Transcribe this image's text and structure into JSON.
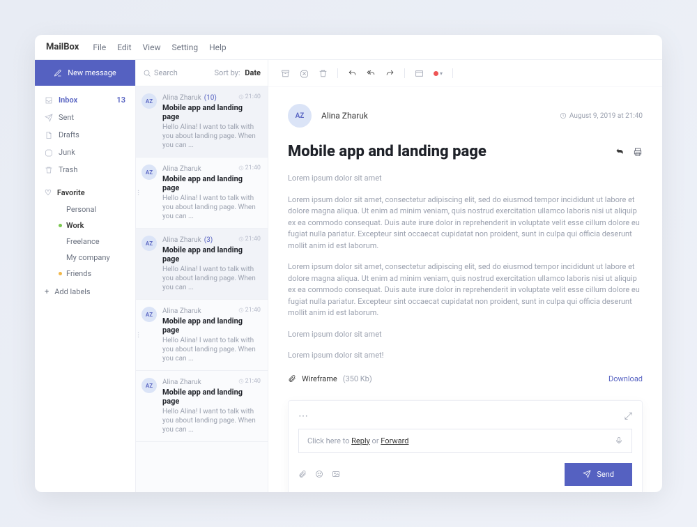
{
  "brand": "MailBox",
  "menu": [
    "File",
    "Edit",
    "View",
    "Setting",
    "Help"
  ],
  "newMessage": "New message",
  "folders": [
    {
      "icon": "inbox",
      "label": "Inbox",
      "badge": "13",
      "active": true
    },
    {
      "icon": "send",
      "label": "Sent"
    },
    {
      "icon": "file",
      "label": "Drafts"
    },
    {
      "icon": "junk",
      "label": "Junk"
    },
    {
      "icon": "trash",
      "label": "Trash"
    }
  ],
  "favorite": {
    "label": "Favorite",
    "items": [
      {
        "label": "Personal"
      },
      {
        "label": "Work",
        "dot": "#7ac74f",
        "selected": true
      },
      {
        "label": "Freelance"
      },
      {
        "label": "My company"
      },
      {
        "label": "Friends",
        "dot": "#f2b84b"
      }
    ]
  },
  "addLabels": "Add  labels",
  "search": "Search",
  "sortBy": "Sort by:",
  "sortVal": "Date",
  "mails": [
    {
      "init": "AZ",
      "sender": "Alina Zharuk",
      "count": "(10)",
      "time": "21:40",
      "subject": "Mobile app and landing page",
      "preview": "Hello Alina! I want to talk with you about landing page. When you can ...",
      "sel": true
    },
    {
      "init": "AZ",
      "sender": "Alina Zharuk",
      "time": "21:40",
      "subject": "Mobile app and landing page",
      "preview": "Hello Alina! I want to talk with you about landing page. When you can ...",
      "dots": true
    },
    {
      "init": "AZ",
      "sender": "Alina Zharuk",
      "count": "(3)",
      "time": "21:40",
      "subject": "Mobile app and landing page",
      "preview": "Hello Alina! I want to talk with you about landing page. When you can ...",
      "sel": true
    },
    {
      "init": "AZ",
      "sender": "Alina Zharuk",
      "time": "21:40",
      "subject": "Mobile app and landing page",
      "preview": "Hello Alina! I want to talk with you about landing page. When you can ...",
      "dots": true
    },
    {
      "init": "AZ",
      "sender": "Alina Zharuk",
      "time": "21:40",
      "subject": "Mobile app and landing page",
      "preview": "Hello Alina! I want to talk with you about landing page. When you can ..."
    }
  ],
  "message": {
    "avatar": "AZ",
    "from": "Alina Zharuk",
    "date": "August 9, 2019 at 21:40",
    "title": "Mobile app and landing page",
    "paras": [
      "Lorem ipsum dolor sit amet",
      "Lorem ipsum dolor sit amet, consectetur adipiscing elit, sed do eiusmod tempor incididunt ut labore et dolore magna aliqua. Ut enim ad minim veniam, quis nostrud exercitation ullamco laboris nisi ut aliquip ex ea commodo consequat. Duis aute irure dolor in reprehenderit in voluptate velit esse cillum dolore eu fugiat nulla pariatur. Excepteur sint occaecat cupidatat non proident, sunt in culpa qui officia deserunt mollit anim id est laborum.",
      "Lorem ipsum dolor sit amet, consectetur adipiscing elit, sed do eiusmod tempor incididunt ut labore et dolore magna aliqua. Ut enim ad minim veniam, quis nostrud exercitation ullamco laboris nisi ut aliquip ex ea commodo consequat. Duis aute irure dolor in reprehenderit in voluptate velit esse cillum dolore eu fugiat nulla pariatur. Excepteur sint occaecat cupidatat non proident, sunt in culpa qui officia deserunt mollit anim id est laborum.",
      "Lorem ipsum dolor sit amet",
      "Lorem ipsum dolor sit amet!"
    ],
    "attachment": {
      "name": "Wireframe",
      "size": "(350 Kb)",
      "download": "Download"
    }
  },
  "reply": {
    "prefix": "Click here to ",
    "replyWord": "Reply",
    "or": " or ",
    "forwardWord": "Forward",
    "send": "Send"
  }
}
